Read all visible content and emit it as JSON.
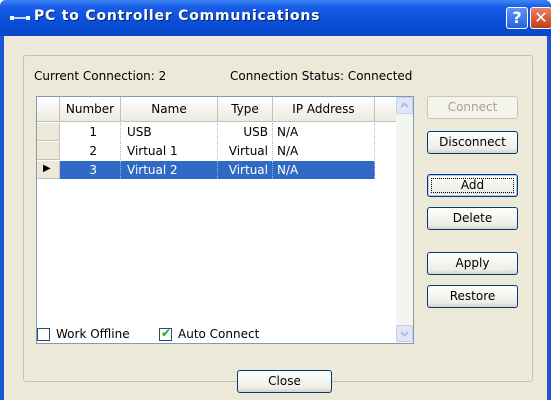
{
  "window": {
    "title": "PC to Controller Communications",
    "help_glyph": "?",
    "close_glyph": "✕"
  },
  "status": {
    "current_connection": "Current Connection: 2",
    "connection_status": "Connection Status: Connected"
  },
  "table": {
    "headers": [
      "Number",
      "Name",
      "Type",
      "IP Address"
    ],
    "rows": [
      {
        "number": "1",
        "name": "USB",
        "type": "USB",
        "ip": "N/A",
        "selected": false
      },
      {
        "number": "2",
        "name": "Virtual 1",
        "type": "Virtual",
        "ip": "N/A",
        "selected": false
      },
      {
        "number": "3",
        "name": "Virtual 2",
        "type": "Virtual",
        "ip": "N/A",
        "selected": true
      }
    ],
    "current_row_marker": "▶"
  },
  "buttons": {
    "connect": "Connect",
    "disconnect": "Disconnect",
    "add": "Add",
    "delete": "Delete",
    "apply": "Apply",
    "restore": "Restore",
    "close": "Close"
  },
  "options": {
    "work_offline": {
      "label": "Work Offline",
      "checked": false
    },
    "auto_connect": {
      "label": "Auto Connect",
      "checked": true
    }
  },
  "colors": {
    "title_bar": "#0a4fd9",
    "selection": "#316ac5",
    "dialog_bg": "#ece9d8"
  }
}
